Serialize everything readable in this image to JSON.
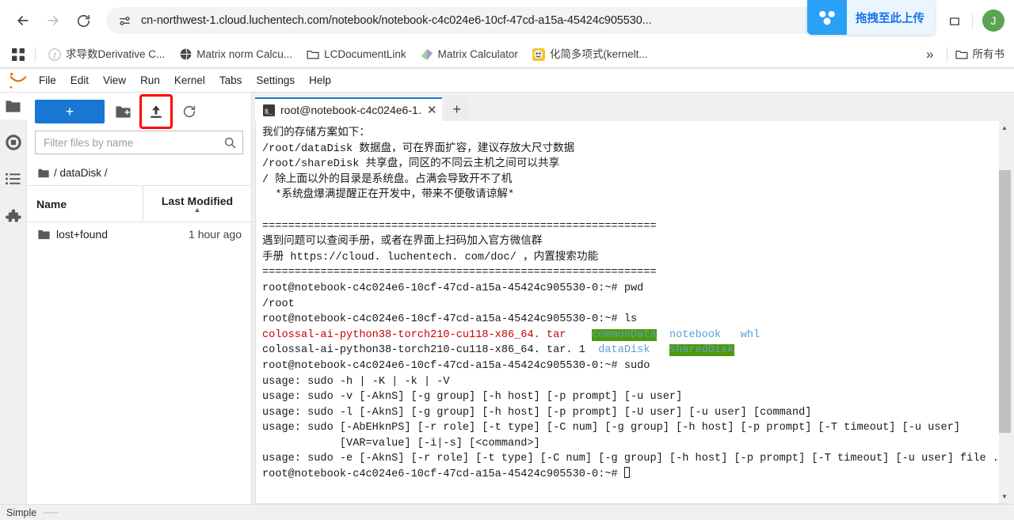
{
  "browser": {
    "back_label": "Back",
    "forward_label": "Forward",
    "reload_label": "Reload",
    "url": "cn-northwest-1.cloud.luchentech.com/notebook/notebook-c4c024e6-10cf-47cd-a15a-45424c905530...",
    "site_info_icon": "tune-icon",
    "star_icon": "star-icon",
    "profile_initial": "J",
    "upload_widget": {
      "label": "拖拽至此上传",
      "icon": "netdisk-icon",
      "accent": "#29a1f7"
    },
    "bookmarks": [
      {
        "label": "求导数Derivative C...",
        "icon": "fx-icon"
      },
      {
        "label": "Matrix norm Calcu...",
        "icon": "globe-icon"
      },
      {
        "label": "LCDocumentLink",
        "icon": "folder-icon"
      },
      {
        "label": "Matrix Calculator",
        "icon": "matrix-icon"
      },
      {
        "label": "化简多项式(kernelt...",
        "icon": "face-icon"
      }
    ],
    "overflow_label": "»",
    "all_bookmarks_label": "所有书",
    "apps_icon": "apps-grid-icon"
  },
  "jupyter": {
    "logo": "jupyter-logo",
    "menus": [
      "File",
      "Edit",
      "View",
      "Run",
      "Kernel",
      "Tabs",
      "Settings",
      "Help"
    ],
    "activity_bar": [
      {
        "name": "file-browser",
        "icon": "folder-icon",
        "active": true
      },
      {
        "name": "running-terminals",
        "icon": "stop-circle-icon",
        "active": false
      },
      {
        "name": "table-of-contents",
        "icon": "list-icon",
        "active": false
      },
      {
        "name": "extension-manager",
        "icon": "puzzle-icon",
        "active": false
      }
    ],
    "file_browser": {
      "new_launcher_label": "+",
      "new_folder_icon": "new-folder-icon",
      "upload_icon": "upload-icon",
      "refresh_icon": "refresh-icon",
      "upload_highlight_color": "#ff0000",
      "filter_placeholder": "Filter files by name",
      "filter_value": "",
      "search_icon": "search-icon",
      "breadcrumb": "/ dataDisk /",
      "breadcrumb_icon": "folder-icon",
      "columns": [
        "Name",
        "Last Modified"
      ],
      "sort_caret": "▲",
      "rows": [
        {
          "name": "lost+found",
          "icon": "folder-icon",
          "modified": "1 hour ago"
        }
      ]
    },
    "dock": {
      "tab_icon": "terminal-icon",
      "tab_title": "root@notebook-c4c024e6-1…",
      "tab_close": "✕",
      "add_tab": "+"
    },
    "status_bar": {
      "left_label": "Simple",
      "right_label": ""
    }
  },
  "terminal": {
    "scrollbar": {
      "up": "▲",
      "down": "▼"
    },
    "cursor": "block",
    "lines": [
      {
        "segments": [
          {
            "text": "我们的存储方案如下：",
            "class": ""
          }
        ]
      },
      {
        "segments": [
          {
            "text": "/root/dataDisk 数据盘，可在界面扩容，建议存放大尺寸数据",
            "class": ""
          }
        ]
      },
      {
        "segments": [
          {
            "text": "/root/shareDisk 共享盘，同区的不同云主机之间可以共享",
            "class": ""
          }
        ]
      },
      {
        "segments": [
          {
            "text": "/ 除上面以外的目录是系统盘。占满会导致开不了机",
            "class": ""
          }
        ]
      },
      {
        "segments": [
          {
            "text": "  *系统盘爆满提醒正在开发中，带来不便敬请谅解*",
            "class": ""
          }
        ]
      },
      {
        "segments": [
          {
            "text": "",
            "class": ""
          }
        ]
      },
      {
        "segments": [
          {
            "text": "=============================================================",
            "class": ""
          }
        ]
      },
      {
        "segments": [
          {
            "text": "遇到问题可以查阅手册，或者在界面上扫码加入官方微信群",
            "class": ""
          }
        ]
      },
      {
        "segments": [
          {
            "text": "手册 https://cloud. luchentech. com/doc/ ，内置搜索功能",
            "class": ""
          }
        ]
      },
      {
        "segments": [
          {
            "text": "=============================================================",
            "class": ""
          }
        ]
      },
      {
        "segments": [
          {
            "text": "root@notebook-c4c024e6-10cf-47cd-a15a-45424c905530-0:~# pwd",
            "class": ""
          }
        ]
      },
      {
        "segments": [
          {
            "text": "/root",
            "class": ""
          }
        ]
      },
      {
        "segments": [
          {
            "text": "root@notebook-c4c024e6-10cf-47cd-a15a-45424c905530-0:~# ls",
            "class": ""
          }
        ]
      },
      {
        "segments": [
          {
            "text": "colossal-ai-python38-torch210-cu118-x86_64. tar",
            "class": "c-red"
          },
          {
            "text": "    ",
            "class": ""
          },
          {
            "text": "commonData",
            "class": "c-bluegreen"
          },
          {
            "text": "  ",
            "class": ""
          },
          {
            "text": "notebook",
            "class": "c-blue"
          },
          {
            "text": "   ",
            "class": ""
          },
          {
            "text": "whl",
            "class": "c-blue"
          }
        ]
      },
      {
        "segments": [
          {
            "text": "colossal-ai-python38-torch210-cu118-x86_64. tar. 1",
            "class": ""
          },
          {
            "text": "  ",
            "class": ""
          },
          {
            "text": "dataDisk",
            "class": "c-blue"
          },
          {
            "text": "   ",
            "class": ""
          },
          {
            "text": "sharedDisk",
            "class": "c-bluegreen"
          }
        ]
      },
      {
        "segments": [
          {
            "text": "root@notebook-c4c024e6-10cf-47cd-a15a-45424c905530-0:~# sudo",
            "class": ""
          }
        ]
      },
      {
        "segments": [
          {
            "text": "usage: sudo -h | -K | -k | -V",
            "class": ""
          }
        ]
      },
      {
        "segments": [
          {
            "text": "usage: sudo -v [-AknS] [-g group] [-h host] [-p prompt] [-u user]",
            "class": ""
          }
        ]
      },
      {
        "segments": [
          {
            "text": "usage: sudo -l [-AknS] [-g group] [-h host] [-p prompt] [-U user] [-u user] [command]",
            "class": ""
          }
        ]
      },
      {
        "segments": [
          {
            "text": "usage: sudo [-AbEHknPS] [-r role] [-t type] [-C num] [-g group] [-h host] [-p prompt] [-T timeout] [-u user]",
            "class": ""
          }
        ]
      },
      {
        "segments": [
          {
            "text": "            [VAR=value] [-i|-s] [<command>]",
            "class": ""
          }
        ]
      },
      {
        "segments": [
          {
            "text": "usage: sudo -e [-AknS] [-r role] [-t type] [-C num] [-g group] [-h host] [-p prompt] [-T timeout] [-u user] file ...",
            "class": ""
          }
        ]
      },
      {
        "segments": [
          {
            "text": "root@notebook-c4c024e6-10cf-47cd-a15a-45424c905530-0:~# ",
            "class": ""
          },
          {
            "text": "█",
            "class": "cursor"
          }
        ]
      }
    ]
  }
}
